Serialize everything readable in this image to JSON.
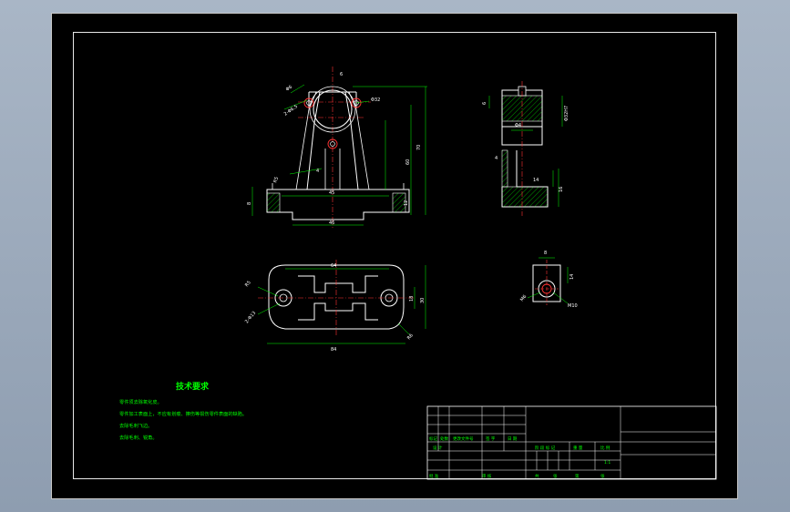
{
  "colors": {
    "outline": "#ffffff",
    "dimension": "#00ff00",
    "hatch": "#00ff00",
    "center": "#ff3333",
    "symbol": "#ffff00",
    "background": "#000000"
  },
  "front_view": {
    "dims": [
      "Φ32",
      "70",
      "60",
      "45",
      "12",
      "46",
      "4",
      "Φ6",
      "8",
      "2-Φ6.5",
      "R5",
      "6"
    ]
  },
  "side_view": {
    "dims": [
      "6",
      "Φ4",
      "Φ32H7",
      "4",
      "14",
      "16"
    ]
  },
  "top_view": {
    "dims": [
      "64",
      "84",
      "18",
      "30",
      "2-Φ13",
      "R5",
      "R6"
    ]
  },
  "detail_view": {
    "dims": [
      "8",
      "14",
      "M6",
      "M10"
    ]
  },
  "notes": {
    "title": "技术要求",
    "lines": [
      "零件须去除氧化皮。",
      "零件加工表面上，不应有划痕、擦伤等损伤零件表面的缺陷。",
      "去除毛刺飞边。",
      "去除毛刺、锐角。"
    ]
  },
  "title_block": {
    "labels": [
      "标记",
      "处数",
      "更改文件号",
      "签 字",
      "日 期",
      "设 计",
      "审 核",
      "阶 段 标 记",
      "重 量",
      "比 例",
      "1:1",
      "共",
      "张",
      "第",
      "张",
      "批 准"
    ]
  }
}
